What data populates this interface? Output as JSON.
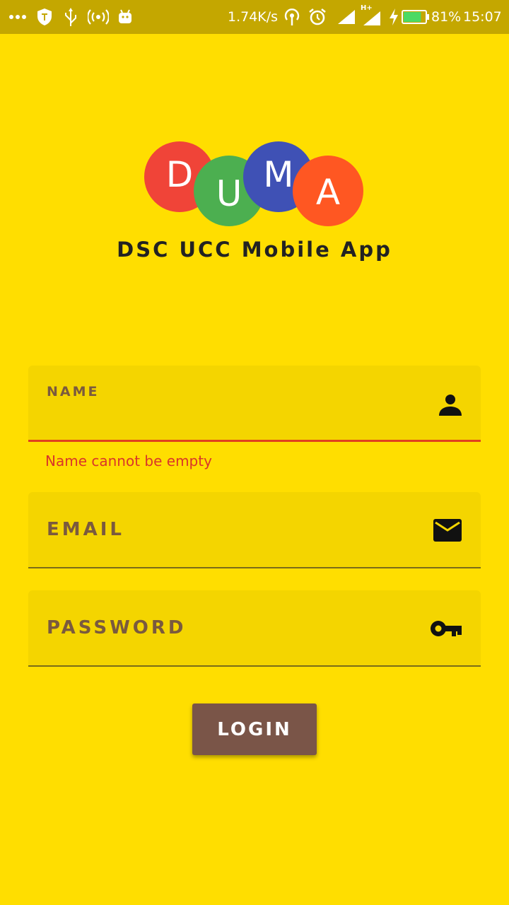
{
  "status_bar": {
    "net_speed": "1.74K/s",
    "network_type": "H+",
    "battery_percent": "81%",
    "battery_level": 0.81,
    "time": "15:07",
    "icons": [
      "more-dots-icon",
      "shield-icon",
      "usb-icon",
      "hotspot-icon",
      "android-icon",
      "wifi-tethering-icon",
      "alarm-icon",
      "signal-icon",
      "signal-icon",
      "charging-icon",
      "battery-icon"
    ]
  },
  "logo": {
    "letters": [
      {
        "char": "D",
        "color": "#F04438"
      },
      {
        "char": "U",
        "color": "#4CAF50"
      },
      {
        "char": "M",
        "color": "#3F51B5"
      },
      {
        "char": "A",
        "color": "#FF5722"
      }
    ]
  },
  "app_title": "DSC UCC Mobile App",
  "form": {
    "name": {
      "label": "NAME",
      "value": "",
      "icon": "person-icon",
      "error": "Name cannot be empty"
    },
    "email": {
      "label": "EMAIL",
      "value": "",
      "icon": "mail-icon"
    },
    "password": {
      "label": "PASSWORD",
      "value": "",
      "icon": "key-icon"
    }
  },
  "login_label": "LOGIN",
  "colors": {
    "background": "#FFDE00",
    "status_bar": "#C4A700",
    "field_fill": "#F4D500",
    "label": "#7A5A3E",
    "error": "#D9352A",
    "button": "#7A5548"
  }
}
